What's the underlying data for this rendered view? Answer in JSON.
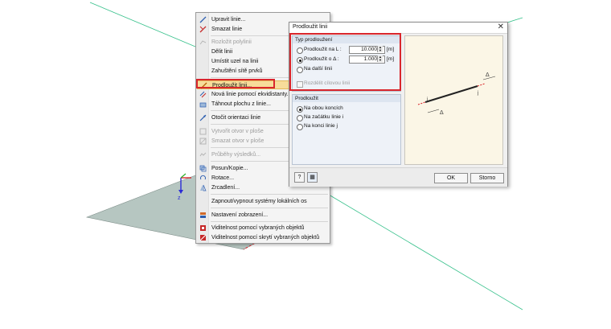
{
  "context_menu": {
    "items": [
      {
        "label": "Upravit linie...",
        "icon": "edit-line-icon",
        "disabled": false
      },
      {
        "label": "Smazat linie",
        "icon": "delete-line-icon",
        "disabled": false
      },
      {
        "label": "Rozložit polylinii",
        "icon": "explode-polyline-icon",
        "disabled": true
      },
      {
        "label": "Dělit linii",
        "icon": "",
        "disabled": false
      },
      {
        "label": "Umístit uzel na linii",
        "icon": "",
        "disabled": false
      },
      {
        "label": "Zahuštění sítě prvků",
        "icon": "",
        "disabled": false
      },
      {
        "label": "Prodloužit linii...",
        "icon": "extend-line-icon",
        "disabled": false,
        "highlighted": true
      },
      {
        "label": "Nová linie pomocí ekvidistanty...",
        "icon": "offset-line-icon",
        "disabled": false
      },
      {
        "label": "Táhnout plochu z linie...",
        "icon": "extrude-surface-icon",
        "disabled": false
      },
      {
        "label": "Otočit orientaci linie",
        "icon": "reverse-orientation-icon",
        "disabled": false
      },
      {
        "label": "Vytvořit otvor v ploše",
        "icon": "create-opening-icon",
        "disabled": true
      },
      {
        "label": "Smazat otvor v ploše",
        "icon": "delete-opening-icon",
        "disabled": true
      },
      {
        "label": "Průběhy výsledků...",
        "icon": "result-diagram-icon",
        "disabled": true
      },
      {
        "label": "Posun/Kopie...",
        "icon": "move-copy-icon",
        "disabled": false
      },
      {
        "label": "Rotace...",
        "icon": "rotate-icon",
        "disabled": false
      },
      {
        "label": "Zrcadlení...",
        "icon": "mirror-icon",
        "disabled": false
      },
      {
        "label": "Zapnout/vypnout systémy lokálních os",
        "icon": "",
        "disabled": false
      },
      {
        "label": "Nastavení zobrazení...",
        "icon": "display-settings-icon",
        "disabled": false
      },
      {
        "label": "Viditelnost pomocí vybraných objektů",
        "icon": "visibility-selected-icon",
        "disabled": false
      },
      {
        "label": "Viditelnost pomocí skrytí vybraných objektů",
        "icon": "visibility-hide-selected-icon",
        "disabled": false
      }
    ]
  },
  "viewport": {
    "axis_label": "z",
    "colors": {
      "plane": "#b6c6c1",
      "axis": "#2b2bd6",
      "guide_line": "#35c08a",
      "highlight": "#d9262c"
    }
  },
  "dialog": {
    "title": "Prodloužit linii",
    "type_group": {
      "title": "Typ prodloužení",
      "options": [
        {
          "label": "Prodloužit na L :",
          "selected": false,
          "value": "10.000",
          "unit": "[m]"
        },
        {
          "label": "Prodloužit o Δ :",
          "selected": true,
          "value": "1.000",
          "unit": "[m]"
        },
        {
          "label": "Na další linii",
          "selected": false
        }
      ],
      "checkbox_label": "Rozdělit cílovou linii"
    },
    "extend_group": {
      "title": "Prodloužit",
      "options": [
        {
          "label": "Na obou koncích",
          "selected": true
        },
        {
          "label": "Na začátku linie i",
          "selected": false
        },
        {
          "label": "Na konci linie j",
          "selected": false
        }
      ]
    },
    "preview": {
      "label_i": "i",
      "label_j": "j",
      "label_delta": "Δ"
    },
    "buttons": {
      "ok": "OK",
      "cancel": "Storno"
    }
  }
}
